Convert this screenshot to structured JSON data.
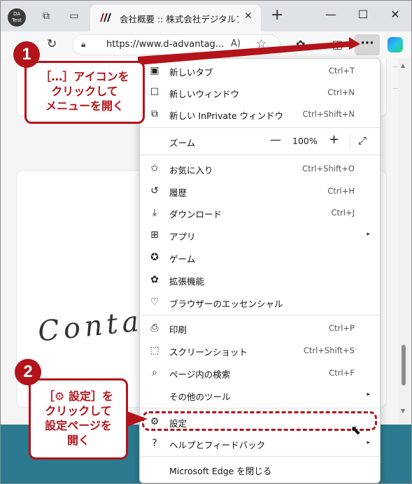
{
  "titlebar": {
    "profile_text": "DA Test",
    "tab_title": "会社概要 :: 株式会社デジタルアドバ",
    "tab_close": "✕",
    "new_tab": "+",
    "minimize": "—",
    "maximize": "☐",
    "close": "✕"
  },
  "toolbar": {
    "reload": "↻",
    "url": "https://www.d-advantag...",
    "read_aloud": "A)",
    "favorite": "☆",
    "extensions_icon": "✿",
    "split_icon": "◫",
    "more": "···"
  },
  "page": {
    "contact_text": "Conta"
  },
  "menu": {
    "items": [
      {
        "label": "新しいタブ",
        "shortcut": "Ctrl+T",
        "icon": "new-tab-icon",
        "glyph": "▣"
      },
      {
        "label": "新しいウィンドウ",
        "shortcut": "Ctrl+N",
        "icon": "new-window-icon",
        "glyph": "☐"
      },
      {
        "label": "新しい InPrivate ウィンドウ",
        "shortcut": "Ctrl+Shift+N",
        "icon": "inprivate-icon",
        "glyph": "⧉"
      },
      {
        "label": "お気に入り",
        "shortcut": "Ctrl+Shift+O",
        "icon": "favorites-icon",
        "glyph": "✩"
      },
      {
        "label": "履歴",
        "shortcut": "Ctrl+H",
        "icon": "history-icon",
        "glyph": "↺"
      },
      {
        "label": "ダウンロード",
        "shortcut": "Ctrl+J",
        "icon": "download-icon",
        "glyph": "⤓"
      },
      {
        "label": "アプリ",
        "shortcut": "",
        "icon": "apps-icon",
        "glyph": "⊞"
      },
      {
        "label": "ゲーム",
        "shortcut": "",
        "icon": "games-icon",
        "glyph": "✪"
      },
      {
        "label": "拡張機能",
        "shortcut": "",
        "icon": "extensions-icon",
        "glyph": "✿"
      },
      {
        "label": "ブラウザーのエッセンシャル",
        "shortcut": "",
        "icon": "essentials-icon",
        "glyph": "♡"
      },
      {
        "label": "印刷",
        "shortcut": "Ctrl+P",
        "icon": "print-icon",
        "glyph": "⎙"
      },
      {
        "label": "スクリーンショット",
        "shortcut": "Ctrl+Shift+S",
        "icon": "screenshot-icon",
        "glyph": "⬚"
      },
      {
        "label": "ページ内の検索",
        "shortcut": "Ctrl+F",
        "icon": "find-icon",
        "glyph": "⌕"
      },
      {
        "label": "その他のツール",
        "shortcut": "",
        "icon": "",
        "glyph": ""
      },
      {
        "label": "設定",
        "shortcut": "",
        "icon": "settings-icon",
        "glyph": "⚙"
      },
      {
        "label": "ヘルプとフィードバック",
        "shortcut": "",
        "icon": "help-icon",
        "glyph": "?"
      },
      {
        "label": "Microsoft Edge を閉じる",
        "shortcut": "",
        "icon": "",
        "glyph": ""
      }
    ],
    "zoom_label": "ズーム",
    "zoom_value": "100%",
    "zoom_minus": "—",
    "zoom_plus": "+",
    "zoom_fullscreen": "⤢",
    "submenu_arrow": "▸"
  },
  "callouts": {
    "step1_number": "1",
    "step1_text_line1": "［…］アイコンを",
    "step1_text_line2": "クリックして",
    "step1_text_line3": "メニューを開く",
    "step2_number": "2",
    "step2_text_line1": "［⚙ 設定］を",
    "step2_text_line2": "クリックして",
    "step2_text_line3": "設定ページを",
    "step2_text_line4": "開く"
  },
  "colors": {
    "accent_red": "#b3131b",
    "footer_teal": "#2c7a8f"
  }
}
